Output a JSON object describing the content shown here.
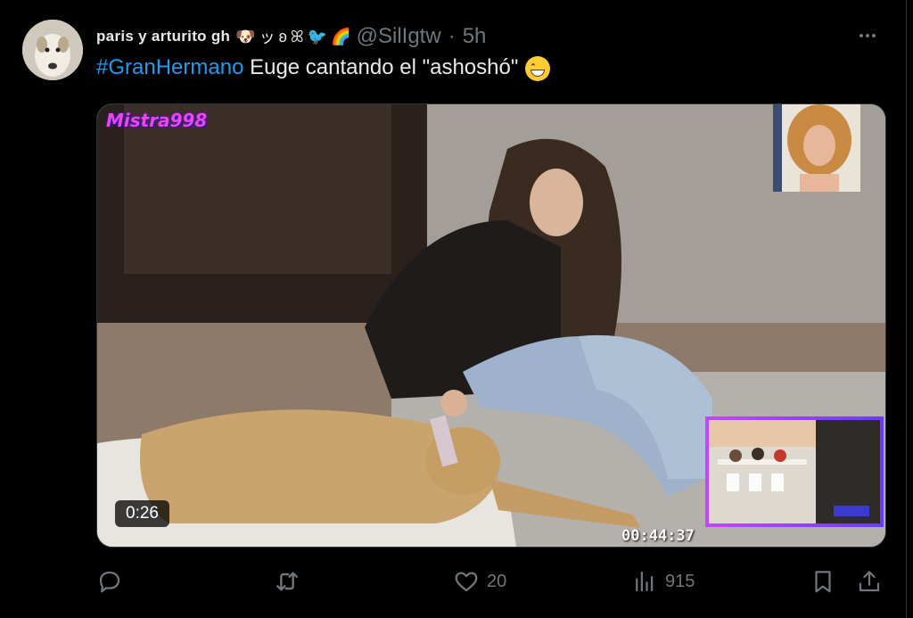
{
  "tweet": {
    "display_name": "paris y arturito gh",
    "name_emojis": [
      "🐶",
      "ッ",
      "ʚ",
      "ꕤ",
      "🐦",
      "🌈"
    ],
    "handle": "@SilIgtw",
    "separator": "·",
    "time": "5h",
    "text": {
      "hashtag": "#GranHermano",
      "body": " Euge cantando el \"ashoshó\""
    }
  },
  "media": {
    "watermark": "Mistra998",
    "timecode": "00:44:37",
    "duration": "0:26"
  },
  "actions": {
    "reply_count": "",
    "retweet_count": "",
    "like_count": "20",
    "views_count": "915"
  },
  "colors": {
    "background": "#000000",
    "text": "#e7e9ea",
    "muted": "#71767b",
    "link": "#1d9bf0",
    "inset_border": "#c146ff"
  },
  "icons": [
    "more-icon",
    "reply-icon",
    "retweet-icon",
    "like-icon",
    "views-icon",
    "bookmark-icon",
    "share-icon"
  ]
}
